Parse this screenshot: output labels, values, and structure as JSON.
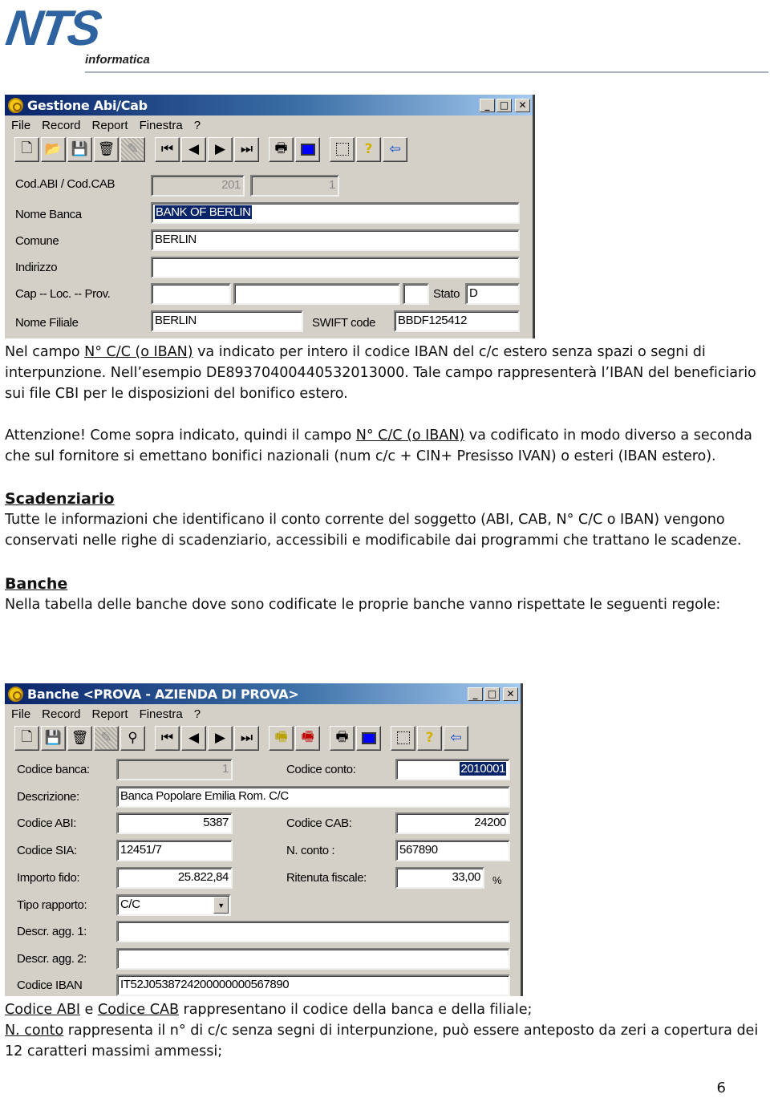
{
  "header": {
    "logo_main": "NTS",
    "logo_sub": "informatica"
  },
  "window1": {
    "title": "Gestione Abi/Cab",
    "controls": {
      "minimize": "_",
      "maximize": "□",
      "close": "✕"
    },
    "menu": [
      "File",
      "Record",
      "Report",
      "Finestra",
      "?"
    ],
    "toolbar_icons": [
      "new-icon",
      "open-icon",
      "save-icon",
      "delete-icon",
      "cancel-icon",
      "first-record-icon",
      "previous-record-icon",
      "next-record-icon",
      "last-record-icon",
      "print-icon",
      "preview-icon",
      "zoom-select-icon",
      "help-icon",
      "exit-icon"
    ],
    "fields": {
      "cod_abi_cab_label": "Cod.ABI / Cod.CAB",
      "cod_abi": "201",
      "cod_cab": "1",
      "nome_banca_label": "Nome Banca",
      "nome_banca": "BANK OF BERLIN",
      "comune_label": "Comune",
      "comune": "BERLIN",
      "indirizzo_label": "Indirizzo",
      "indirizzo": "",
      "cap_loc_prov_label": "Cap -- Loc. -- Prov.",
      "cap": "",
      "localita": "",
      "provincia": "",
      "stato_label": "Stato",
      "stato": "D",
      "nome_filiale_label": "Nome Filiale",
      "nome_filiale": "BERLIN",
      "swift_label": "SWIFT code",
      "swift": "BBDF125412"
    }
  },
  "text1": {
    "p1_a": "Nel campo ",
    "p1_link": "N° C/C (o IBAN)",
    "p1_b": " va indicato per intero il codice IBAN del c/c estero senza spazi o segni di interpunzione. Nell’esempio DE89370400440532013000. Tale campo rappresenterà l’IBAN del beneficiario sui file CBI per le disposizioni del bonifico estero.",
    "p2_a": "Attenzione! Come sopra indicato, quindi il campo ",
    "p2_link": "N° C/C (o IBAN)",
    "p2_b": " va codificato in modo diverso a seconda che sul fornitore si emettano bonifici nazionali (num c/c + CIN+ Presisso IVAN) o esteri (IBAN estero).",
    "h_scadenziario": "Scadenziario",
    "p3": "Tutte le informazioni che identificano il conto corrente del soggetto (ABI, CAB, N° C/C o IBAN) vengono conservati nelle righe di scadenziario, accessibili e modificabile dai programmi che trattano le scadenze.",
    "h_banche": "Banche",
    "p4": "Nella tabella delle banche dove sono codificate le proprie banche vanno rispettate le seguenti regole:"
  },
  "window2": {
    "title": "Banche <PROVA - AZIENDA DI PROVA>",
    "controls": {
      "minimize": "_",
      "maximize": "□",
      "close": "✕"
    },
    "menu": [
      "File",
      "Record",
      "Report",
      "Finestra",
      "?"
    ],
    "toolbar_icons": [
      "new-icon",
      "save-icon",
      "delete-icon",
      "cancel-icon",
      "search-icon",
      "first-record-icon",
      "previous-record-icon",
      "next-record-icon",
      "last-record-icon",
      "fax-yellow-icon",
      "fax-red-icon",
      "print-icon",
      "preview-icon",
      "zoom-select-icon",
      "help-icon",
      "exit-icon"
    ],
    "fields": {
      "codice_banca_label": "Codice banca:",
      "codice_banca": "1",
      "codice_conto_label": "Codice conto:",
      "codice_conto": "2010001",
      "descrizione_label": "Descrizione:",
      "descrizione": "Banca Popolare Emilia Rom. C/C",
      "codice_abi_label": "Codice ABI:",
      "codice_abi": "5387",
      "codice_cab_label": "Codice CAB:",
      "codice_cab": "24200",
      "codice_sia_label": "Codice SIA:",
      "codice_sia": "12451/7",
      "n_conto_label": "N. conto :",
      "n_conto": "567890",
      "importo_fido_label": "Importo fido:",
      "importo_fido": "25.822,84",
      "ritenuta_label": "Ritenuta fiscale:",
      "ritenuta": "33,00",
      "ritenuta_unit": "%",
      "tipo_rapporto_label": "Tipo rapporto:",
      "tipo_rapporto": "C/C",
      "descr_agg1_label": "Descr. agg. 1:",
      "descr_agg1": "",
      "descr_agg2_label": "Descr. agg. 2:",
      "descr_agg2": "",
      "iban_label": "Codice IBAN",
      "iban": "IT52J0538724200000000567890"
    }
  },
  "text2": {
    "l1_link1": "Codice ABI",
    "l1_mid": " e ",
    "l1_link2": "Codice CAB",
    "l1_b": " rappresentano il codice della banca e della filiale;",
    "l2_link": "N. conto",
    "l2_b": " rappresenta il n° di c/c senza segni di interpunzione, può essere anteposto da zeri a copertura dei 12 caratteri massimi ammessi;"
  },
  "page_number": "6"
}
